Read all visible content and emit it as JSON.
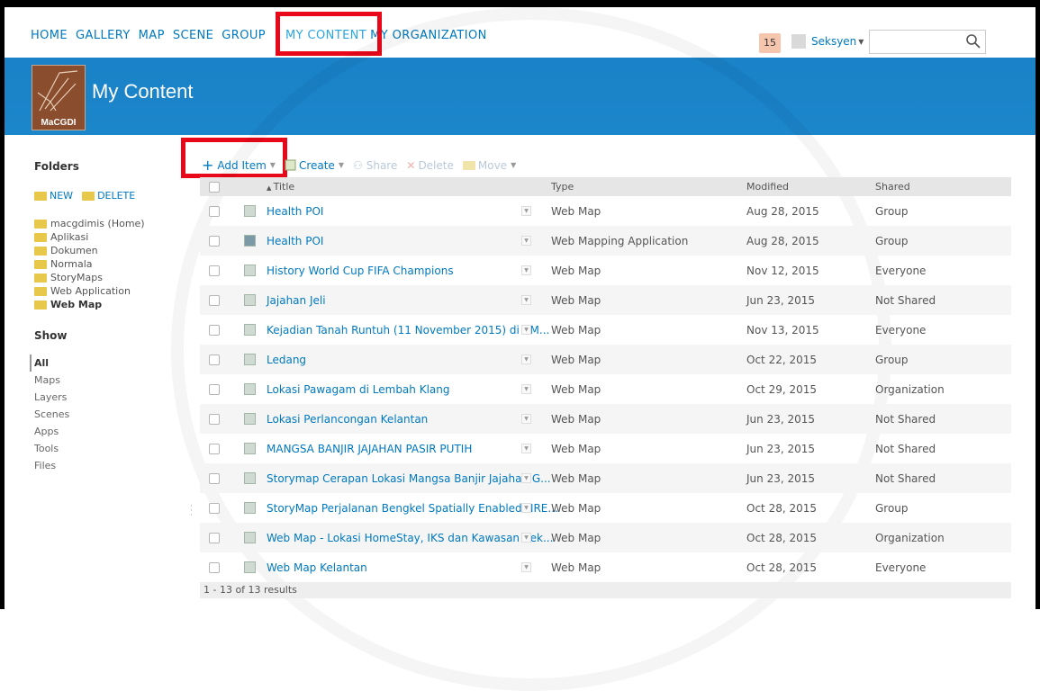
{
  "nav": {
    "items": [
      "HOME",
      "GALLERY",
      "MAP",
      "SCENE",
      "GROUP",
      "MY CONTENT",
      "MY ORGANIZATION"
    ],
    "active": "MY CONTENT",
    "notification_count": "15",
    "username": "Seksyen",
    "search_placeholder": ""
  },
  "banner": {
    "logo_text": "MaCGDI",
    "title": "My Content"
  },
  "sidebar": {
    "folders_heading": "Folders",
    "new_label": "NEW",
    "delete_label": "DELETE",
    "folders": [
      "macgdimis (Home)",
      "Aplikasi",
      "Dokumen",
      "Normala",
      "StoryMaps",
      "Web Application",
      "Web Map"
    ],
    "selected_folder": "Web Map",
    "show_heading": "Show",
    "show": [
      "All",
      "Maps",
      "Layers",
      "Scenes",
      "Apps",
      "Tools",
      "Files"
    ],
    "selected_show": "All"
  },
  "toolbar": {
    "add_item": "Add Item",
    "create": "Create",
    "share": "Share",
    "delete": "Delete",
    "move": "Move"
  },
  "table": {
    "headers": {
      "title": "Title",
      "type": "Type",
      "modified": "Modified",
      "shared": "Shared"
    },
    "rows": [
      {
        "title": "Health POI",
        "type": "Web Map",
        "modified": "Aug 28, 2015",
        "shared": "Group",
        "icon": "web-map-icon"
      },
      {
        "title": "Health POI",
        "type": "Web Mapping Application",
        "modified": "Aug 28, 2015",
        "shared": "Group",
        "icon": "web-app-icon"
      },
      {
        "title": "History World Cup FIFA Champions",
        "type": "Web Map",
        "modified": "Nov 12, 2015",
        "shared": "Everyone",
        "icon": "web-map-icon"
      },
      {
        "title": "Jajahan Jeli",
        "type": "Web Map",
        "modified": "Jun 23, 2015",
        "shared": "Not Shared",
        "icon": "web-map-icon"
      },
      {
        "title": "Kejadian Tanah Runtuh (11 November 2015) di KM...",
        "type": "Web Map",
        "modified": "Nov 13, 2015",
        "shared": "Everyone",
        "icon": "web-map-icon"
      },
      {
        "title": "Ledang",
        "type": "Web Map",
        "modified": "Oct 22, 2015",
        "shared": "Group",
        "icon": "web-map-icon"
      },
      {
        "title": "Lokasi Pawagam di Lembah Klang",
        "type": "Web Map",
        "modified": "Oct 29, 2015",
        "shared": "Organization",
        "icon": "web-map-icon"
      },
      {
        "title": "Lokasi Perlancongan Kelantan",
        "type": "Web Map",
        "modified": "Jun 23, 2015",
        "shared": "Not Shared",
        "icon": "web-map-icon"
      },
      {
        "title": "MANGSA BANJIR JAJAHAN PASIR PUTIH",
        "type": "Web Map",
        "modified": "Jun 23, 2015",
        "shared": "Not Shared",
        "icon": "web-map-icon"
      },
      {
        "title": "Storymap Cerapan Lokasi Mangsa Banjir Jajahan G...",
        "type": "Web Map",
        "modified": "Jun 23, 2015",
        "shared": "Not Shared",
        "icon": "web-map-icon"
      },
      {
        "title": "StoryMap Perjalanan Bengkel Spatially Enabled NRE...",
        "type": "Web Map",
        "modified": "Oct 28, 2015",
        "shared": "Group",
        "icon": "web-map-icon"
      },
      {
        "title": "Web Map - Lokasi HomeStay, IKS dan Kawasan Rek...",
        "type": "Web Map",
        "modified": "Oct 28, 2015",
        "shared": "Organization",
        "icon": "web-map-icon"
      },
      {
        "title": "Web Map Kelantan",
        "type": "Web Map",
        "modified": "Oct 28, 2015",
        "shared": "Everyone",
        "icon": "web-map-icon"
      }
    ],
    "results": "1 - 13 of 13 results"
  },
  "colors": {
    "accent": "#0079c1",
    "banner": "#1a82c7",
    "highlight": "#e8081a"
  }
}
